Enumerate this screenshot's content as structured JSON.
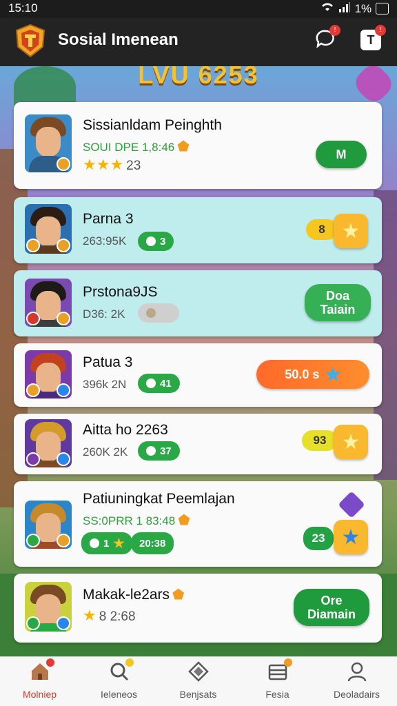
{
  "status_bar": {
    "time": "15:10",
    "battery": "1%"
  },
  "app_bar": {
    "title": "Sosial Imenean",
    "chat_badge": "!",
    "notif_badge": "!",
    "notif_icon_label": "T"
  },
  "banner": {
    "headline": "LVU 6253"
  },
  "list": [
    {
      "name": "Sissianldam Peinghth",
      "subtitle": "SOUI DPE 1,8:46",
      "stars": "★★★",
      "rating": "23",
      "button": "M",
      "highlighted": false
    },
    {
      "name": "Parna 3",
      "meta": "263:95K",
      "chip": "3",
      "pill": "8",
      "highlighted": true
    },
    {
      "name": "Prstona9JS",
      "meta": "D36: 2K",
      "chip": "",
      "button_line1": "Doa",
      "button_line2": "Taiain",
      "highlighted": true
    },
    {
      "name": "Patua 3",
      "meta": "396k 2N",
      "chip": "41",
      "button": "50.0 s",
      "highlighted": false
    },
    {
      "name": "Aitta ho 2263",
      "meta": "260K 2K",
      "chip": "37",
      "pill": "93",
      "highlighted": false
    },
    {
      "name": "Patiuningkat Peemlajan",
      "subtitle": "SS:0PRR 1 83:48",
      "chip_a": "1",
      "chip_b": "20:38",
      "pill": "23",
      "highlighted": false
    },
    {
      "name": "Makak-le2ars",
      "rating": "8 2:68",
      "button_line1": "Ore",
      "button_line2": "Diamain",
      "highlighted": false
    }
  ],
  "bottom_nav": [
    {
      "label": "Molniep",
      "icon": "home-icon",
      "active": true
    },
    {
      "label": "Ieleneos",
      "icon": "search-icon",
      "active": false
    },
    {
      "label": "Benjsats",
      "icon": "gem-icon",
      "active": false
    },
    {
      "label": "Fesia",
      "icon": "inbox-icon",
      "active": false
    },
    {
      "label": "Deoladairs",
      "icon": "profile-icon",
      "active": false
    }
  ],
  "colors": {
    "accent_green": "#1f9a3c",
    "highlight_row": "#bfeced",
    "nav_active": "#d33a2c"
  }
}
